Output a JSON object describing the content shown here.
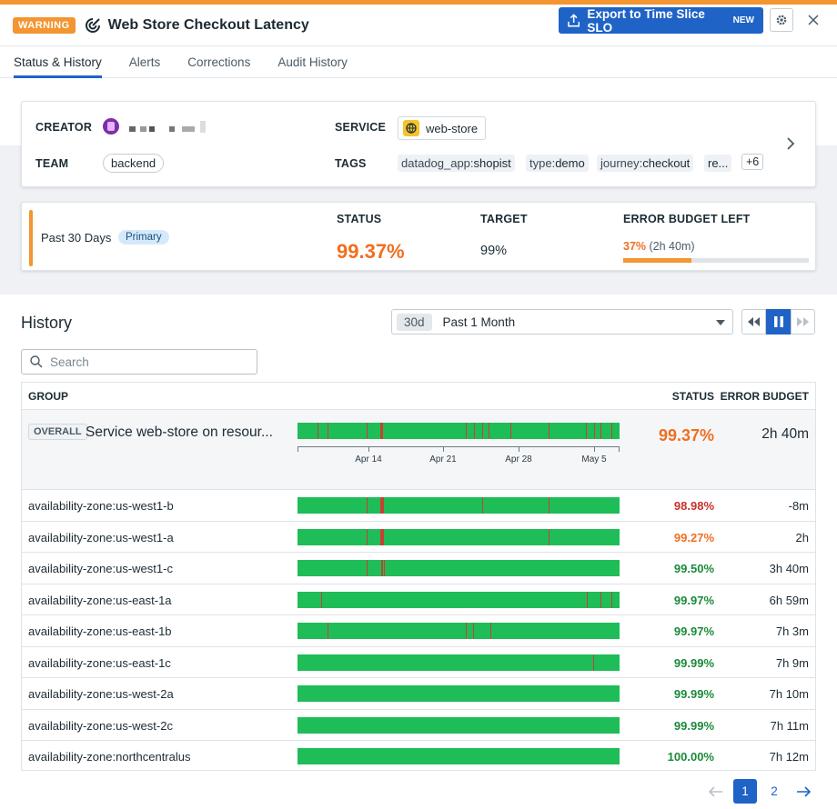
{
  "header": {
    "badge": "WARNING",
    "title": "Web Store Checkout Latency",
    "export_label": "Export to Time Slice SLO",
    "export_new": "NEW"
  },
  "tabs": [
    "Status & History",
    "Alerts",
    "Corrections",
    "Audit History"
  ],
  "info": {
    "creator_label": "CREATOR",
    "team_label": "TEAM",
    "team": "backend",
    "service_label": "SERVICE",
    "service": "web-store",
    "tags_label": "TAGS",
    "tags": [
      {
        "key": "datadog_app:",
        "val": "shopist"
      },
      {
        "key": "type:",
        "val": "demo"
      },
      {
        "key": "journey:",
        "val": "checkout"
      },
      {
        "key": "",
        "val": "re..."
      }
    ],
    "tags_more": "+6"
  },
  "summary": {
    "period": "Past 30 Days",
    "primary": "Primary",
    "status_label": "STATUS",
    "status": "99.37%",
    "target_label": "TARGET",
    "target": "99%",
    "budget_label": "ERROR BUDGET LEFT",
    "budget_pct": "37%",
    "budget_time": "(2h 40m)",
    "budget_fraction": 0.37
  },
  "history": {
    "title": "History",
    "range_short": "30d",
    "range_label": "Past 1 Month",
    "search_placeholder": "Search",
    "col_group": "GROUP",
    "col_status": "STATUS",
    "col_budget": "ERROR BUDGET",
    "overall": {
      "badge": "OVERALL",
      "name": "Service web-store on resour...",
      "status": "99.37%",
      "budget": "2h 40m"
    },
    "axis": [
      "Apr 14",
      "Apr 21",
      "Apr 28",
      "May 5"
    ],
    "rows": [
      {
        "group": "availability-zone:us-west1-b",
        "status": "98.98%",
        "budget": "-8m",
        "color": "#c9302c"
      },
      {
        "group": "availability-zone:us-west1-a",
        "status": "99.27%",
        "budget": "2h",
        "color": "#f06f20"
      },
      {
        "group": "availability-zone:us-west1-c",
        "status": "99.50%",
        "budget": "3h 40m",
        "color": "#1b8a3a"
      },
      {
        "group": "availability-zone:us-east-1a",
        "status": "99.97%",
        "budget": "6h 59m",
        "color": "#1b8a3a"
      },
      {
        "group": "availability-zone:us-east-1b",
        "status": "99.97%",
        "budget": "7h 3m",
        "color": "#1b8a3a"
      },
      {
        "group": "availability-zone:us-east-1c",
        "status": "99.99%",
        "budget": "7h 9m",
        "color": "#1b8a3a"
      },
      {
        "group": "availability-zone:us-west-2a",
        "status": "99.99%",
        "budget": "7h 10m",
        "color": "#1b8a3a"
      },
      {
        "group": "availability-zone:us-west-2c",
        "status": "99.99%",
        "budget": "7h 11m",
        "color": "#1b8a3a"
      },
      {
        "group": "availability-zone:northcentralus",
        "status": "100.00%",
        "budget": "7h 12m",
        "color": "#1b8a3a"
      }
    ]
  },
  "pager": {
    "pages": [
      "1",
      "2"
    ],
    "current": "1"
  }
}
